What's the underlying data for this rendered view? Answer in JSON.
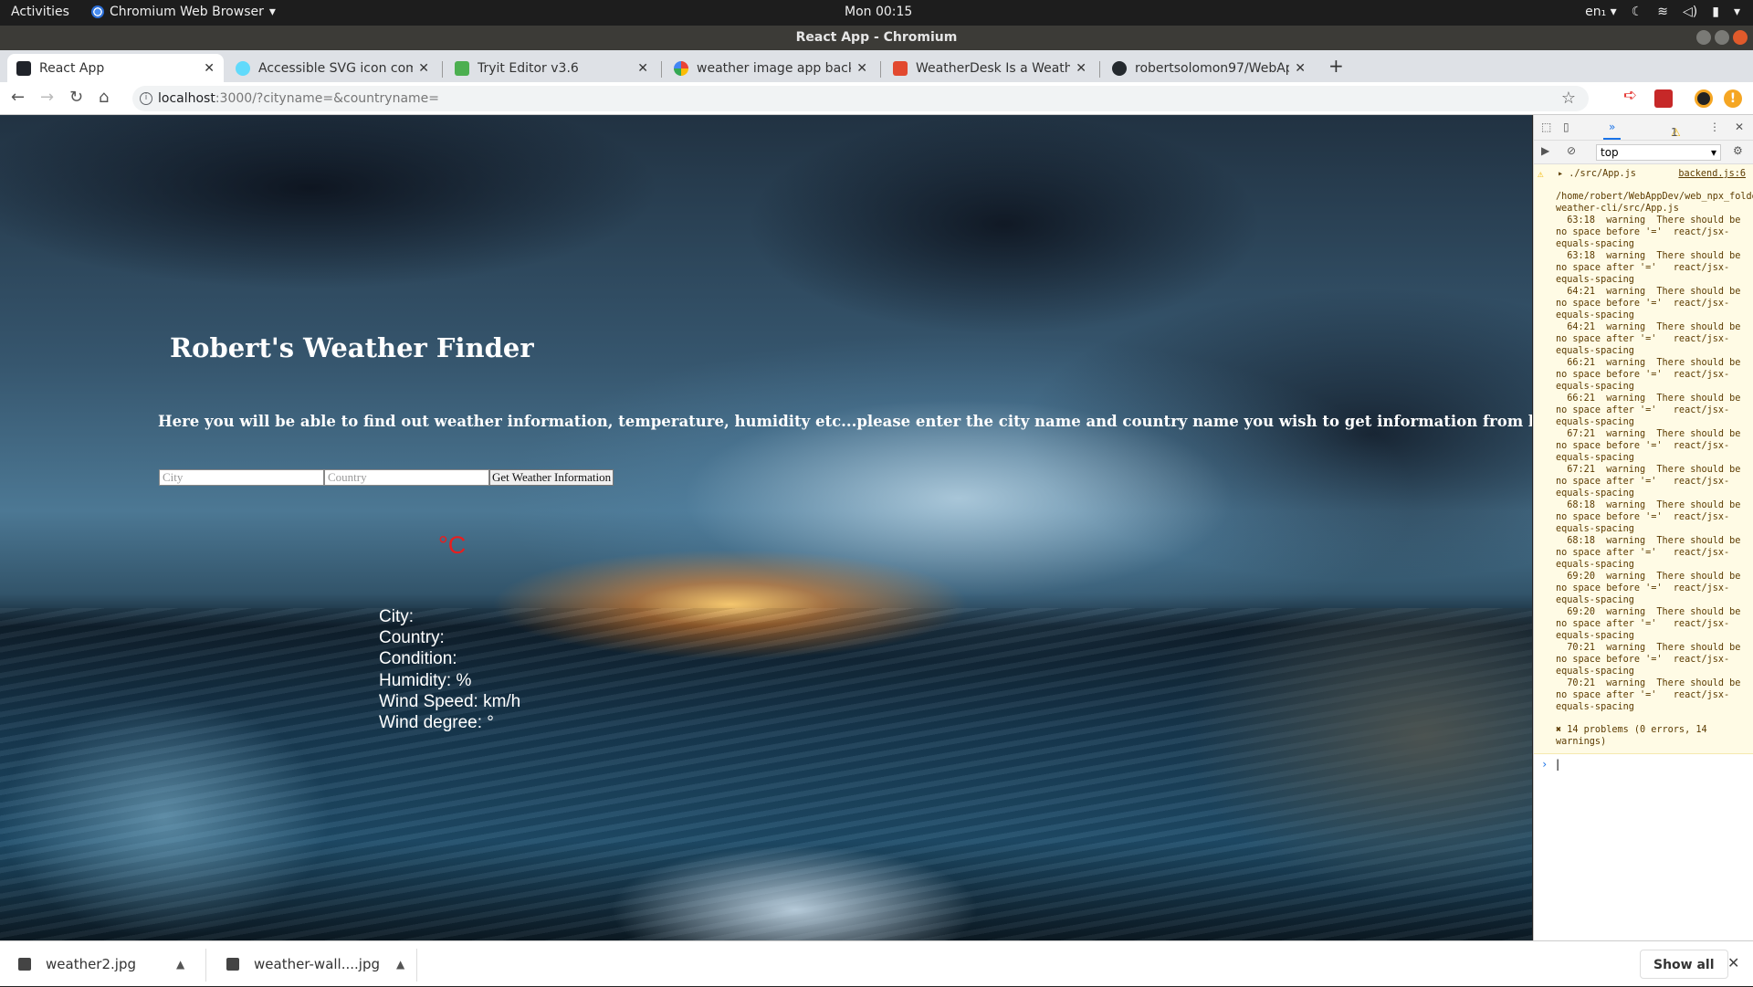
{
  "os": {
    "activities": "Activities",
    "app_name": "Chromium Web Browser",
    "clock": "Mon 00:15",
    "lang": "en₁"
  },
  "window": {
    "title": "React App - Chromium"
  },
  "tabs": [
    {
      "title": "React App",
      "favicon_color": "#20232a"
    },
    {
      "title": "Accessible SVG icon comp",
      "favicon_color": "#61dafb"
    },
    {
      "title": "Tryit Editor v3.6",
      "favicon_color": "#4caf50"
    },
    {
      "title": "weather image app backg",
      "favicon_color": "#4285f4"
    },
    {
      "title": "WeatherDesk Is a Weathe",
      "favicon_color": "#e2492f"
    },
    {
      "title": "robertsolomon97/WebAp",
      "favicon_color": "#24292e"
    }
  ],
  "address": {
    "host": "localhost",
    "rest": ":3000/?cityname=&countryname="
  },
  "page": {
    "title": "Robert's Weather Finder",
    "description": "Here you will be able to find out weather information, temperature, humidity etc...please enter the city name and country name you wish to get information from below",
    "city_placeholder": "City",
    "country_placeholder": "Country",
    "city_value": "",
    "country_value": "",
    "button_label": "Get Weather Information",
    "temperature": "°C",
    "details": {
      "city": "City:",
      "country": "Country:",
      "condition": "Condition:",
      "humidity": "Humidity: %",
      "wind_speed": "Wind Speed: km/h",
      "wind_degree": "Wind degree: °"
    }
  },
  "devtools": {
    "warning_badge": "1",
    "context": "top",
    "warning_file": "./src/App.js",
    "warning_link": "backend.js:6",
    "warning_body": "/home/robert/WebAppDev/web_npx_folder/react-weather-cli/src/App.js\n  63:18  warning  There should be no space before '='  react/jsx-equals-spacing\n  63:18  warning  There should be no space after '='   react/jsx-equals-spacing\n  64:21  warning  There should be no space before '='  react/jsx-equals-spacing\n  64:21  warning  There should be no space after '='   react/jsx-equals-spacing\n  66:21  warning  There should be no space before '='  react/jsx-equals-spacing\n  66:21  warning  There should be no space after '='   react/jsx-equals-spacing\n  67:21  warning  There should be no space before '='  react/jsx-equals-spacing\n  67:21  warning  There should be no space after '='   react/jsx-equals-spacing\n  68:18  warning  There should be no space before '='  react/jsx-equals-spacing\n  68:18  warning  There should be no space after '='   react/jsx-equals-spacing\n  69:20  warning  There should be no space before '='  react/jsx-equals-spacing\n  69:20  warning  There should be no space after '='   react/jsx-equals-spacing\n  70:21  warning  There should be no space before '='  react/jsx-equals-spacing\n  70:21  warning  There should be no space after '='   react/jsx-equals-spacing",
    "summary": "✖ 14 problems (0 errors, 14 warnings)"
  },
  "downloads": {
    "items": [
      {
        "name": "weather2.jpg"
      },
      {
        "name": "weather-wall....jpg"
      }
    ],
    "show_all": "Show all"
  }
}
